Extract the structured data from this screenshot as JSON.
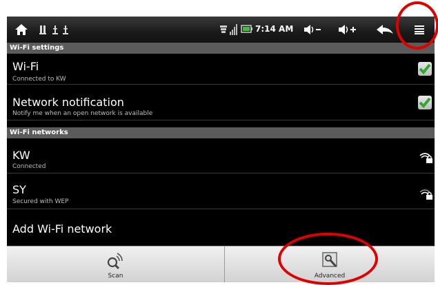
{
  "statusbar": {
    "time": "7:14 AM"
  },
  "sections": {
    "wifi_settings": "Wi-Fi settings",
    "wifi_networks": "Wi-Fi networks"
  },
  "wifi": {
    "title": "Wi-Fi",
    "subtitle": "Connected to KW",
    "checked": true
  },
  "network_notification": {
    "title": "Network notification",
    "subtitle": "Notify me when an open network is available",
    "checked": true
  },
  "networks": [
    {
      "ssid": "KW",
      "status": "Connected",
      "icon": "wifi-lock-icon"
    },
    {
      "ssid": "SY",
      "status": "Secured with WEP",
      "icon": "wifi-lock-icon"
    }
  ],
  "add_network": "Add Wi-Fi network",
  "bottom_bar": {
    "scan_label": "Scan",
    "advanced_label": "Advanced"
  },
  "colors": {
    "check_green": "#2fa82f",
    "annotation_red": "#e00000"
  }
}
